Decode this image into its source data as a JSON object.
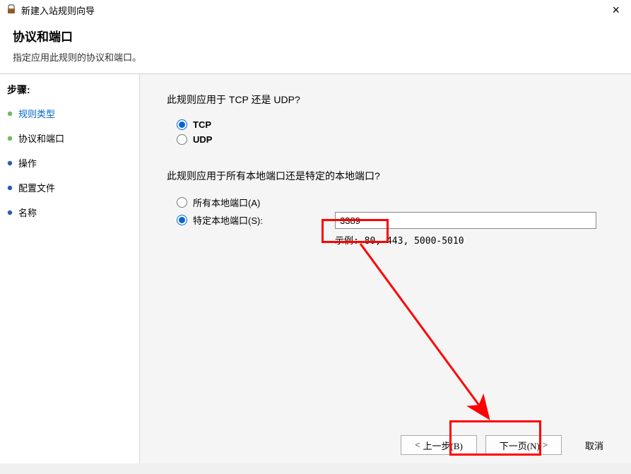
{
  "window": {
    "title": "新建入站规则向导",
    "close": "×"
  },
  "header": {
    "title": "协议和端口",
    "subtitle": "指定应用此规则的协议和端口。"
  },
  "sidebar": {
    "steps_label": "步骤:",
    "items": [
      {
        "label": "规则类型",
        "active": true,
        "bullet": "green"
      },
      {
        "label": "协议和端口",
        "active": false,
        "bullet": "green"
      },
      {
        "label": "操作",
        "active": false,
        "bullet": "blue"
      },
      {
        "label": "配置文件",
        "active": false,
        "bullet": "blue"
      },
      {
        "label": "名称",
        "active": false,
        "bullet": "blue"
      }
    ]
  },
  "content": {
    "q1": "此规则应用于 TCP 还是 UDP?",
    "tcp_label": "TCP",
    "udp_label": "UDP",
    "q2": "此规则应用于所有本地端口还是特定的本地端口?",
    "all_ports_label": "所有本地端口(A)",
    "specific_ports_label": "特定本地端口(S):",
    "port_value": "3389",
    "example_prefix": "示例: ",
    "example_value": "80, 443, 5000-5010"
  },
  "footer": {
    "back": "上一步(B)",
    "next": "下一页(N)",
    "cancel": "取消"
  }
}
